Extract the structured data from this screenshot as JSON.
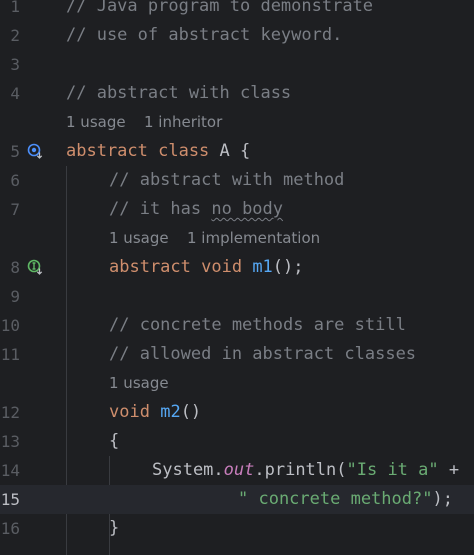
{
  "editor": {
    "lines": [
      {
        "num": "1",
        "parts": [
          "// Java program to demonstrate"
        ]
      },
      {
        "num": "2",
        "parts": [
          "// use of abstract keyword."
        ]
      },
      {
        "num": "3"
      },
      {
        "num": "4",
        "parts": [
          "// abstract with class"
        ]
      },
      {
        "hint": [
          "1 usage",
          "1 inheritor"
        ]
      },
      {
        "num": "5",
        "parts": [
          "abstract class",
          " A {"
        ]
      },
      {
        "num": "6",
        "parts": [
          "// abstract with method"
        ]
      },
      {
        "num": "7",
        "parts": [
          "// it has ",
          "no body"
        ]
      },
      {
        "hint": [
          "1 usage",
          "1 implementation"
        ]
      },
      {
        "num": "8",
        "parts": [
          "abstract void",
          " ",
          "m1",
          "();"
        ]
      },
      {
        "num": "9"
      },
      {
        "num": "10",
        "parts": [
          "// concrete methods are still"
        ]
      },
      {
        "num": "11",
        "parts": [
          "// allowed in abstract classes"
        ]
      },
      {
        "hint": [
          "1 usage"
        ]
      },
      {
        "num": "12",
        "parts": [
          "void",
          " ",
          "m2",
          "()"
        ]
      },
      {
        "num": "13",
        "parts": [
          "{"
        ]
      },
      {
        "num": "14",
        "parts": [
          "System.",
          "out",
          ".println(",
          "\"Is it a\"",
          " +"
        ]
      },
      {
        "num": "15",
        "parts": [
          "\" concrete method?\"",
          ");"
        ]
      },
      {
        "num": "16",
        "parts": [
          "}"
        ]
      }
    ],
    "gutter_icons": {
      "line5": "implemented-override-icon",
      "line8": "implemented-method-icon"
    },
    "colors": {
      "background": "#1e1f22",
      "comment": "#7a7e85",
      "keyword": "#cf8e6d",
      "function": "#56a8f5",
      "string": "#6aab73",
      "static_field": "#c77dbb",
      "text": "#bcbec4",
      "current_line": "#26282e"
    }
  }
}
